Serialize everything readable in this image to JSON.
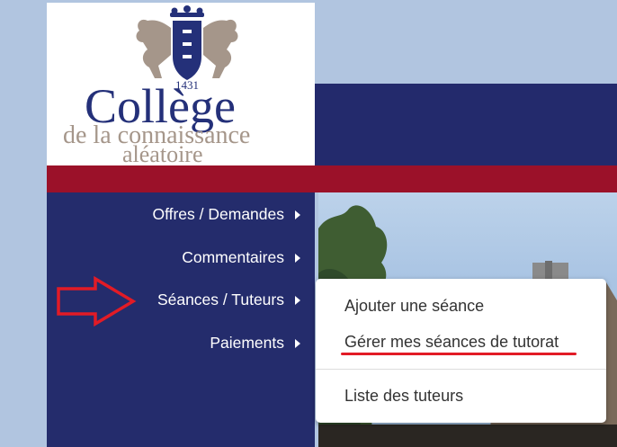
{
  "logo": {
    "year": "1431",
    "name": "Collège",
    "tagline_line1": "de la connaissance",
    "tagline_line2": "aléatoire"
  },
  "menu": {
    "items": [
      {
        "label": "Offres / Demandes"
      },
      {
        "label": "Commentaires"
      },
      {
        "label": "Séances / Tuteurs"
      },
      {
        "label": "Paiements"
      }
    ]
  },
  "dropdown": {
    "items": [
      {
        "label": "Ajouter une séance"
      },
      {
        "label": "Gérer mes séances de tutorat"
      },
      {
        "label": "Liste des tuteurs"
      }
    ]
  },
  "colors": {
    "navy": "#232a6c",
    "crimson": "#9b1129",
    "annotation_red": "#e21b26"
  }
}
